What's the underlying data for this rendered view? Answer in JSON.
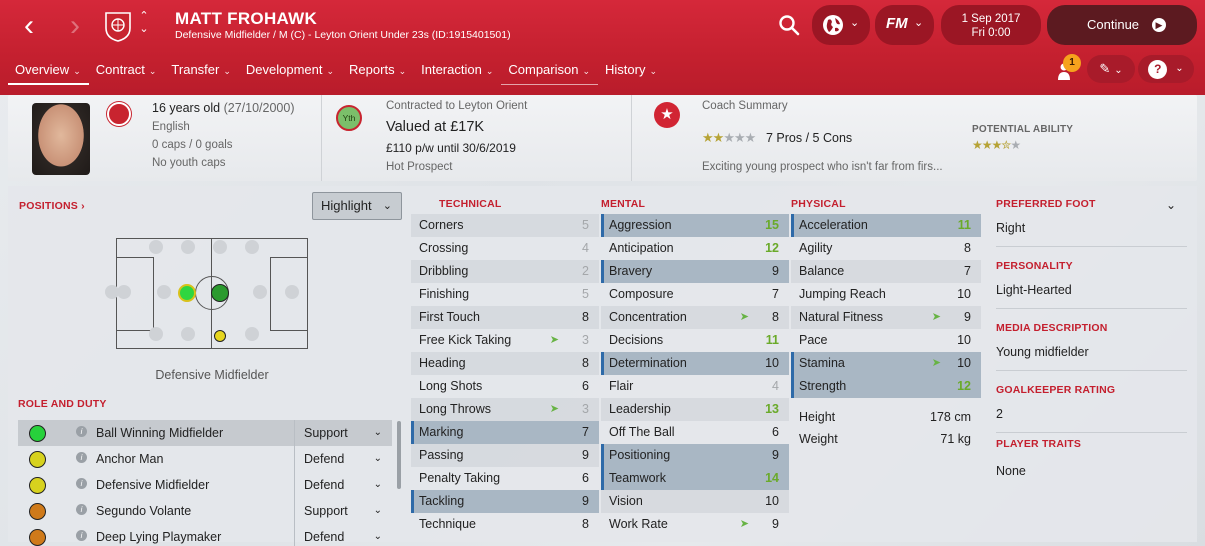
{
  "player": {
    "name": "MATT FROHAWK",
    "subtitle": "Defensive Midfielder / M (C) - Leyton Orient Under 23s (ID:1915401501)"
  },
  "topbar": {
    "date_line1": "1 Sep 2017",
    "date_line2": "Fri 0:00",
    "continue_label": "Continue",
    "fm_label": "FM"
  },
  "tabs": [
    {
      "label": "Overview"
    },
    {
      "label": "Contract"
    },
    {
      "label": "Transfer"
    },
    {
      "label": "Development"
    },
    {
      "label": "Reports"
    },
    {
      "label": "Interaction"
    },
    {
      "label": "Comparison"
    },
    {
      "label": "History"
    }
  ],
  "notifications": {
    "count": "1"
  },
  "header": {
    "age": "16 years old",
    "dob": "(27/10/2000)",
    "nationality": "English",
    "caps": "0 caps / 0 goals",
    "youth_caps": "No youth caps",
    "contract_title": "Contracted to Leyton Orient",
    "value": "Valued at £17K",
    "wage": "£110 p/w until 30/6/2019",
    "status": "Hot Prospect",
    "youth_badge": "Yth",
    "coach_title": "Coach Summary",
    "pros_cons": "7 Pros / 5 Cons",
    "current_ability_stars": 2,
    "potential_label": "POTENTIAL ABILITY",
    "potential_ability_stars": 3.5,
    "summary": "Exciting young prospect who isn't far from firs..."
  },
  "positions": {
    "title": "POSITIONS",
    "highlight_label": "Highlight",
    "position_label": "Defensive Midfielder"
  },
  "roles": {
    "title": "ROLE AND DUTY",
    "items": [
      {
        "name": "Ball Winning Midfielder",
        "duty": "Support",
        "color": "#27d13b"
      },
      {
        "name": "Anchor Man",
        "duty": "Defend",
        "color": "#d7d21e"
      },
      {
        "name": "Defensive Midfielder",
        "duty": "Defend",
        "color": "#d7d21e"
      },
      {
        "name": "Segundo Volante",
        "duty": "Support",
        "color": "#cf7a1a"
      },
      {
        "name": "Deep Lying Playmaker",
        "duty": "Defend",
        "color": "#cf7a1a"
      }
    ]
  },
  "technical": {
    "title": "TECHNICAL",
    "items": [
      {
        "name": "Corners",
        "value": "5"
      },
      {
        "name": "Crossing",
        "value": "4"
      },
      {
        "name": "Dribbling",
        "value": "2"
      },
      {
        "name": "Finishing",
        "value": "5"
      },
      {
        "name": "First Touch",
        "value": "8"
      },
      {
        "name": "Free Kick Taking",
        "value": "3"
      },
      {
        "name": "Heading",
        "value": "8"
      },
      {
        "name": "Long Shots",
        "value": "6"
      },
      {
        "name": "Long Throws",
        "value": "3"
      },
      {
        "name": "Marking",
        "value": "7"
      },
      {
        "name": "Passing",
        "value": "9"
      },
      {
        "name": "Penalty Taking",
        "value": "6"
      },
      {
        "name": "Tackling",
        "value": "9"
      },
      {
        "name": "Technique",
        "value": "8"
      }
    ]
  },
  "mental": {
    "title": "MENTAL",
    "items": [
      {
        "name": "Aggression",
        "value": "15"
      },
      {
        "name": "Anticipation",
        "value": "12"
      },
      {
        "name": "Bravery",
        "value": "9"
      },
      {
        "name": "Composure",
        "value": "7"
      },
      {
        "name": "Concentration",
        "value": "8"
      },
      {
        "name": "Decisions",
        "value": "11"
      },
      {
        "name": "Determination",
        "value": "10"
      },
      {
        "name": "Flair",
        "value": "4"
      },
      {
        "name": "Leadership",
        "value": "13"
      },
      {
        "name": "Off The Ball",
        "value": "6"
      },
      {
        "name": "Positioning",
        "value": "9"
      },
      {
        "name": "Teamwork",
        "value": "14"
      },
      {
        "name": "Vision",
        "value": "10"
      },
      {
        "name": "Work Rate",
        "value": "9"
      }
    ]
  },
  "physical": {
    "title": "PHYSICAL",
    "items": [
      {
        "name": "Acceleration",
        "value": "11"
      },
      {
        "name": "Agility",
        "value": "8"
      },
      {
        "name": "Balance",
        "value": "7"
      },
      {
        "name": "Jumping Reach",
        "value": "10"
      },
      {
        "name": "Natural Fitness",
        "value": "9"
      },
      {
        "name": "Pace",
        "value": "10"
      },
      {
        "name": "Stamina",
        "value": "10"
      },
      {
        "name": "Strength",
        "value": "12"
      }
    ],
    "height_label": "Height",
    "height_value": "178 cm",
    "weight_label": "Weight",
    "weight_value": "71 kg"
  },
  "info": {
    "preferred_foot_title": "PREFERRED FOOT",
    "preferred_foot": "Right",
    "personality_title": "PERSONALITY",
    "personality": "Light-Hearted",
    "media_title": "MEDIA DESCRIPTION",
    "media": "Young midfielder",
    "gk_title": "GOALKEEPER RATING",
    "gk": "2",
    "traits_title": "PLAYER TRAITS",
    "traits": "None"
  }
}
